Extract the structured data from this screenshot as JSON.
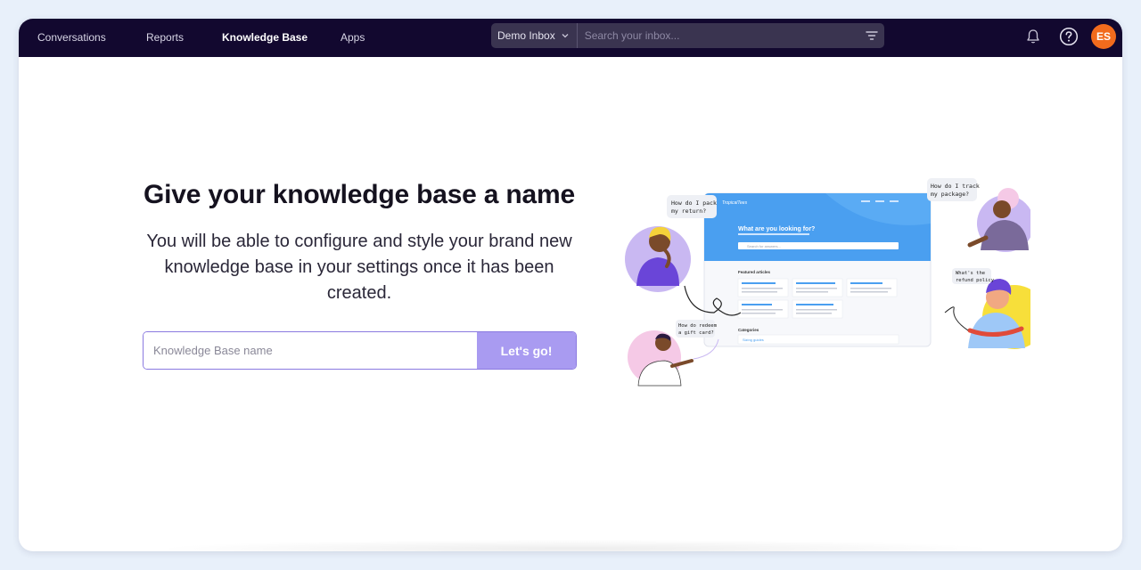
{
  "nav": {
    "items": [
      {
        "label": "Conversations",
        "active": false
      },
      {
        "label": "Reports",
        "active": false
      },
      {
        "label": "Knowledge Base",
        "active": true
      },
      {
        "label": "Apps",
        "active": false
      }
    ]
  },
  "search": {
    "inbox_label": "Demo Inbox",
    "placeholder": "Search your inbox..."
  },
  "user": {
    "initials": "ES",
    "avatar_color": "#f26b1d"
  },
  "main": {
    "headline": "Give your knowledge base a name",
    "subtext": "You will be able to configure and style your brand new knowledge base in your settings once it has been created.",
    "input_placeholder": "Knowledge Base name",
    "submit_label": "Let's go!"
  },
  "illustration": {
    "bubbles": [
      "How do I pack my return?",
      "How do I track my package?",
      "What's the refund policy",
      "How do redeem a gift card?"
    ],
    "mock_heading": "What are you looking for?",
    "mock_search": "Search for answers...",
    "mock_section": "Featured articles",
    "mock_categories": "Categories",
    "mock_category_item": "Sizing guides"
  },
  "colors": {
    "navbar": "#12082f",
    "accent": "#a99bf1",
    "brand_blue": "#4a9ff0"
  }
}
